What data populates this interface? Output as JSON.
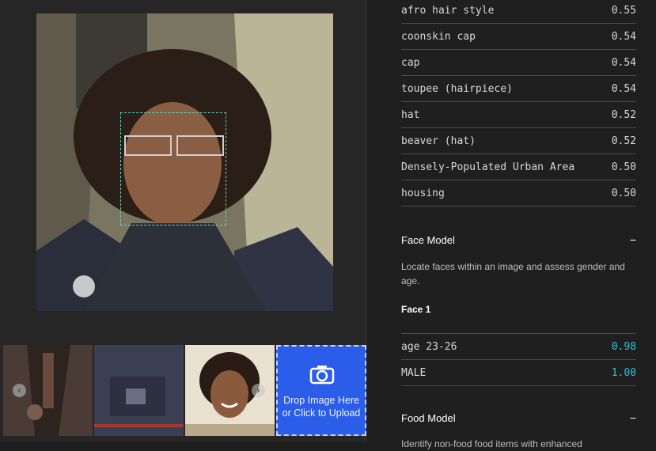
{
  "upload": {
    "line1": "Drop Image Here",
    "line2": "or Click to Upload"
  },
  "tags": [
    {
      "label": "afro hair style",
      "score": "0.55"
    },
    {
      "label": "coonskin cap",
      "score": "0.54"
    },
    {
      "label": "cap",
      "score": "0.54"
    },
    {
      "label": "toupee (hairpiece)",
      "score": "0.54"
    },
    {
      "label": "hat",
      "score": "0.52"
    },
    {
      "label": "beaver (hat)",
      "score": "0.52"
    },
    {
      "label": "Densely-Populated Urban Area",
      "score": "0.50"
    },
    {
      "label": "housing",
      "score": "0.50"
    }
  ],
  "face_model": {
    "title": "Face Model",
    "toggle": "−",
    "description": "Locate faces within an image and assess gender and age.",
    "face_label": "Face 1",
    "results": [
      {
        "label": "age 23-26",
        "score": "0.98"
      },
      {
        "label": "MALE",
        "score": "1.00"
      }
    ]
  },
  "food_model": {
    "title": "Food Model",
    "toggle": "−",
    "description": "Identify non-food food items with enhanced"
  },
  "icons": {
    "prev": "chevron-left-icon",
    "next": "chevron-right-icon",
    "upload": "camera-icon"
  },
  "colors": {
    "accent": "#2ec4d6",
    "upload_bg": "#2b5de8",
    "face_box": "#5fd3c7"
  }
}
